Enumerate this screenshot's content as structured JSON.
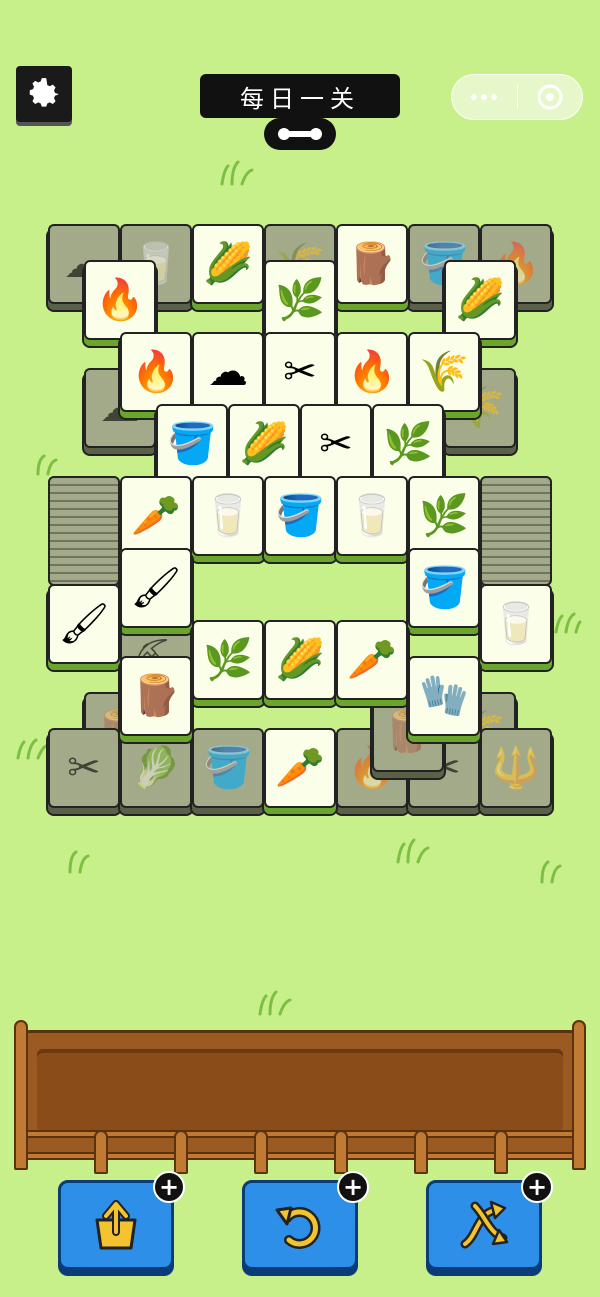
{
  "header": {
    "title": "每日一关",
    "settings_icon": "gear-icon",
    "key_icon": "key-icon",
    "menu_icon": "more-dots-icon",
    "close_icon": "target-circle-icon"
  },
  "colors": {
    "background": "#c7f08a",
    "tile_face": "#fbffe9",
    "tile_dim": "#a3aa8a",
    "tray_wood": "#9b5a22",
    "button_blue": "#2d8fe8"
  },
  "tiles_top": [
    {
      "icon": "🔥",
      "name": "campfire"
    },
    {
      "icon": "🌽",
      "name": "corn"
    },
    {
      "icon": "🌿",
      "name": "grass"
    },
    {
      "icon": "🪵",
      "name": "stump"
    },
    {
      "icon": "🌽",
      "name": "corn"
    },
    {
      "icon": "🔥",
      "name": "campfire"
    },
    {
      "icon": "☁",
      "name": "cotton"
    },
    {
      "icon": "✂",
      "name": "shears"
    },
    {
      "icon": "🔥",
      "name": "campfire"
    },
    {
      "icon": "🌾",
      "name": "wheat"
    },
    {
      "icon": "🪣",
      "name": "bucket"
    },
    {
      "icon": "🌽",
      "name": "corn"
    },
    {
      "icon": "✂",
      "name": "shears"
    },
    {
      "icon": "🌿",
      "name": "grass"
    },
    {
      "icon": "🥕",
      "name": "carrot"
    },
    {
      "icon": "🥛",
      "name": "milk"
    },
    {
      "icon": "🪣",
      "name": "bucket"
    },
    {
      "icon": "🥛",
      "name": "milk"
    },
    {
      "icon": "🌿",
      "name": "grass"
    },
    {
      "icon": "🖌",
      "name": "brush"
    },
    {
      "icon": "🪣",
      "name": "bucket"
    },
    {
      "icon": "🖌",
      "name": "brush"
    },
    {
      "icon": "🥛",
      "name": "milk"
    },
    {
      "icon": "🌿",
      "name": "grass"
    },
    {
      "icon": "🌽",
      "name": "corn"
    },
    {
      "icon": "🥕",
      "name": "carrot"
    },
    {
      "icon": "🪵",
      "name": "stump"
    },
    {
      "icon": "🧤",
      "name": "glove"
    },
    {
      "icon": "🥕",
      "name": "carrot"
    }
  ],
  "powerups": [
    {
      "name": "move-out",
      "icon": "box-arrow-icon"
    },
    {
      "name": "undo",
      "icon": "undo-arrow-icon"
    },
    {
      "name": "shuffle",
      "icon": "shuffle-icon"
    }
  ]
}
